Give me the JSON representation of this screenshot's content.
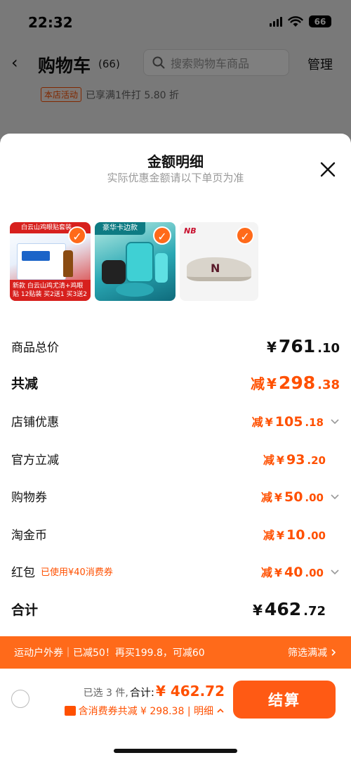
{
  "status_bar": {
    "time": "22:32",
    "battery": "66"
  },
  "nav": {
    "back": "‹",
    "title": "购物车",
    "count": "(66)",
    "search_placeholder": "搜索购物车商品",
    "manage": "管理"
  },
  "store_promo": {
    "tag": "本店活动",
    "text": "已享满1件打 5.80 折"
  },
  "sheet": {
    "title": "金额明细",
    "subtitle": "实际优惠金额请以下单页为准",
    "products": [
      {
        "name": "eye-drop-product",
        "banner": "白云山鸡眼贴套装",
        "bottom": "新款 白云山鸡尤清+鸡眼贴 12贴装 买2送1 买3送2",
        "checked": true
      },
      {
        "name": "outdoor-bucket-product",
        "banner": "豪华卡边款",
        "checked": true
      },
      {
        "name": "new-balance-shoe-product",
        "logo": "NB",
        "checked": true
      }
    ],
    "rows": {
      "total_price": {
        "label": "商品总价",
        "yen": "¥",
        "int": "761",
        "dec": ".10"
      },
      "total_discount": {
        "label": "共减",
        "prefix": "减",
        "yen": "¥",
        "int": "298",
        "dec": ".38"
      },
      "shop_discount": {
        "label": "店铺优惠",
        "prefix": "减",
        "yen": "¥",
        "int": "105",
        "dec": ".18"
      },
      "official_discount": {
        "label": "官方立减",
        "prefix": "减",
        "yen": "¥",
        "int": "93",
        "dec": ".20"
      },
      "shopping_coupon": {
        "label": "购物券",
        "prefix": "减",
        "yen": "¥",
        "int": "50",
        "dec": ".00"
      },
      "taojinbi": {
        "label": "淘金币",
        "prefix": "减",
        "yen": "¥",
        "int": "10",
        "dec": ".00"
      },
      "red_packet": {
        "label": "红包",
        "note": "已使用¥40消费券",
        "prefix": "减",
        "yen": "¥",
        "int": "40",
        "dec": ".00"
      },
      "subtotal": {
        "label": "合计",
        "yen": "¥",
        "int": "462",
        "dec": ".72"
      }
    }
  },
  "promo_bar": {
    "left": "运动户外券｜已减50！再买199.8，可减60",
    "right": "筛选满减"
  },
  "footer": {
    "selected": "已选 3 件,",
    "total_label": "合计:",
    "total_amount": "¥ 462.72",
    "savings": "含消费券共减 ¥ 298.38 | 明细",
    "checkout": "结算"
  },
  "colors": {
    "accent": "#ff5000",
    "button": "#ff5a14",
    "banner": "#ff6a1a"
  }
}
